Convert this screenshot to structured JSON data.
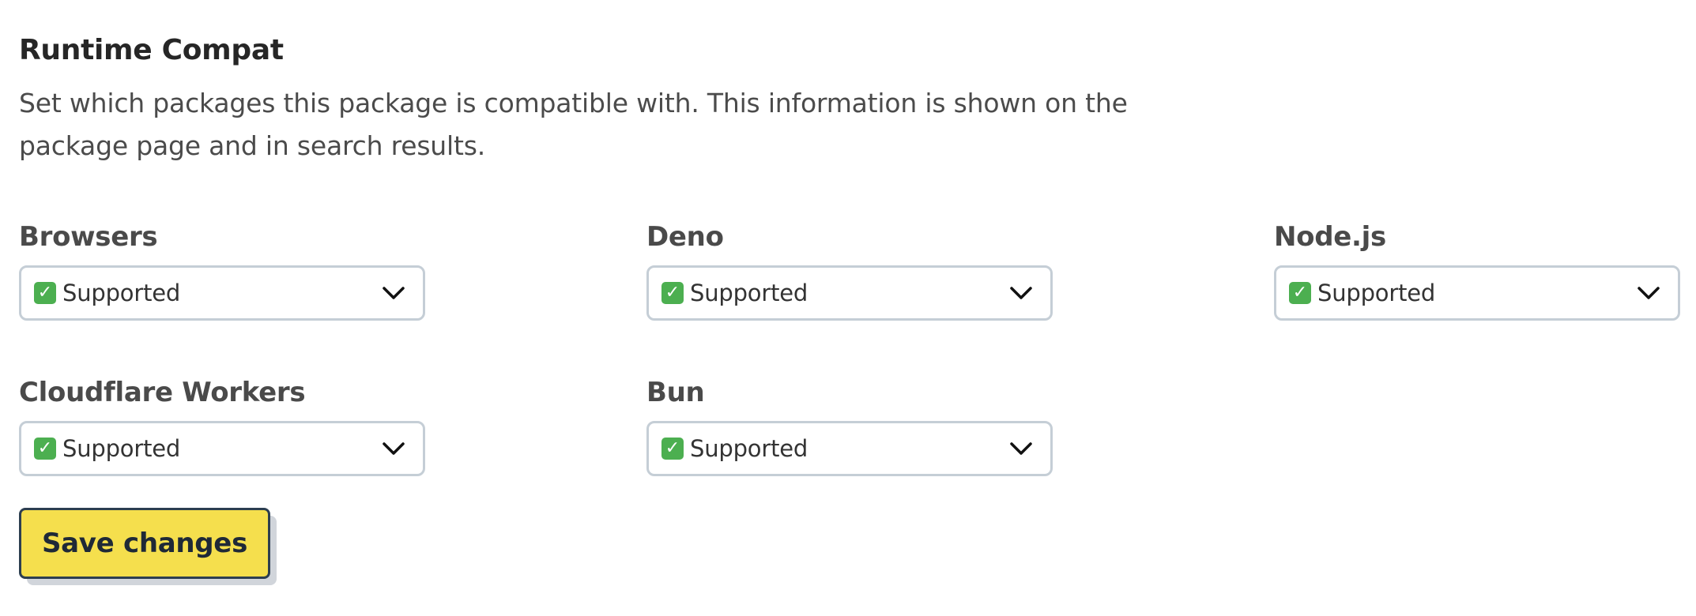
{
  "section": {
    "title": "Runtime Compat",
    "description": "Set which packages this package is compatible with. This information is shown on the package page and in search results."
  },
  "runtimes": [
    {
      "label": "Browsers",
      "value": "Supported",
      "icon": "check-mark-button-emoji"
    },
    {
      "label": "Deno",
      "value": "Supported",
      "icon": "check-mark-button-emoji"
    },
    {
      "label": "Node.js",
      "value": "Supported",
      "icon": "check-mark-button-emoji"
    },
    {
      "label": "Cloudflare Workers",
      "value": "Supported",
      "icon": "check-mark-button-emoji"
    },
    {
      "label": "Bun",
      "value": "Supported",
      "icon": "check-mark-button-emoji"
    }
  ],
  "actions": {
    "save_label": "Save changes"
  },
  "colors": {
    "save_button_bg": "#f5df4d",
    "save_button_border": "#2c3e50",
    "select_border": "#c5ced6",
    "check_emoji_bg": "#4caf50"
  }
}
